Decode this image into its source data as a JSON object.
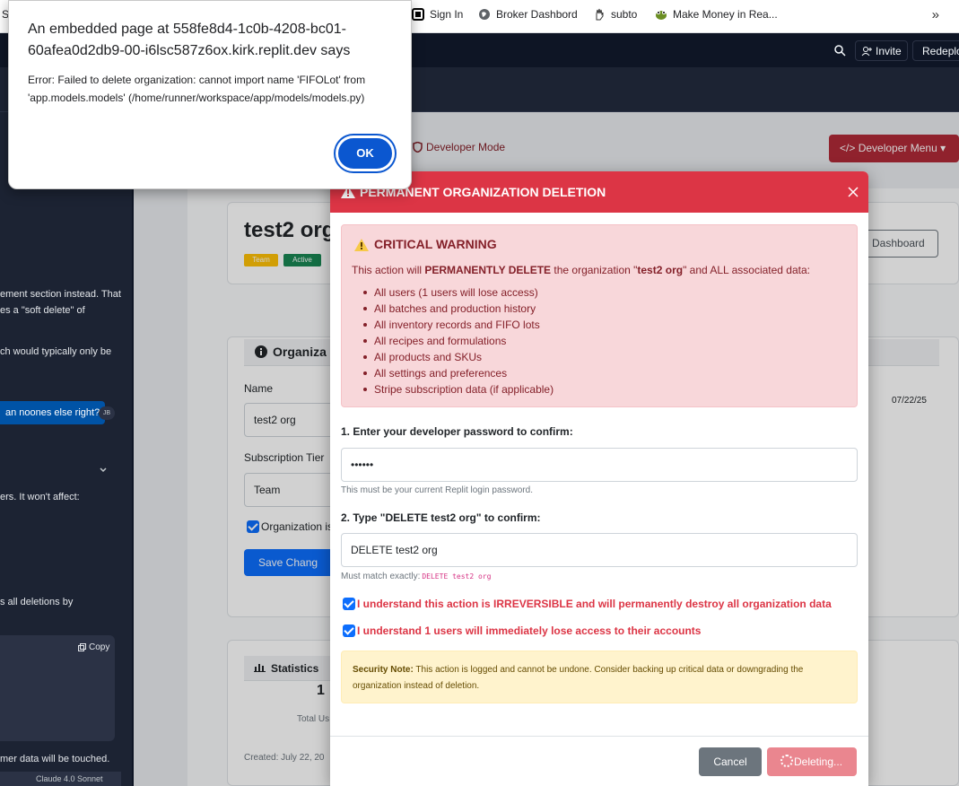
{
  "bookmarks": {
    "partial_left": "S",
    "items": [
      {
        "label": "Sign In",
        "icon": "sign-in-icon"
      },
      {
        "label": "Broker Dashbord",
        "icon": "globe-icon"
      },
      {
        "label": "subto",
        "icon": "hand-icon"
      },
      {
        "label": "Make Money in Rea...",
        "icon": "frog-icon"
      }
    ],
    "more": "»"
  },
  "replit": {
    "invite_label": "Invite",
    "redeploy_label": "Redeploy"
  },
  "chat": {
    "lines": [
      "ement section instead. That",
      "es a \"soft delete\" of",
      "ch would typically only be",
      "ers. It won't affect:",
      "s all deletions by",
      "mer data will be touched."
    ],
    "bubble": "an noones else right?",
    "avatar": "JB",
    "copy_label": "Copy",
    "model": "Claude 4.0 Sonnet"
  },
  "app": {
    "developer_mode": "Developer Mode",
    "developer_menu": "Developer Menu",
    "org_title": "test2 org",
    "badge_tier": "Team",
    "badge_status": "Active",
    "dashboard_btn": "Dashboard",
    "info_section": "Organiza",
    "name_label": "Name",
    "name_value": "test2 org",
    "tier_label": "Subscription Tier",
    "tier_value": "Team",
    "active_label": "Organization is",
    "save_label": "Save Chang",
    "date_value": "07/22/25",
    "stats_label": "Statistics",
    "stats_value": "1",
    "stats_sub": "Total Us",
    "created": "Created: July 22, 20"
  },
  "modal": {
    "title": "PERMANENT ORGANIZATION DELETION",
    "warning_title": "CRITICAL WARNING",
    "warning_prefix": "This action will ",
    "warning_bold": "PERMANENTLY DELETE",
    "warning_mid": " the organization \"",
    "warning_org": "test2 org",
    "warning_suffix": "\" and ALL associated data:",
    "warning_items": [
      "All users (1 users will lose access)",
      "All batches and production history",
      "All inventory records and FIFO lots",
      "All recipes and formulations",
      "All products and SKUs",
      "All settings and preferences",
      "Stripe subscription data (if applicable)"
    ],
    "step1_label": "1. Enter your developer password to confirm:",
    "password_value": "••••••",
    "step1_help": "This must be your current Replit login password.",
    "step2_label": "2. Type \"DELETE test2 org\" to confirm:",
    "confirm_value": "DELETE test2 org",
    "step2_help": "Must match exactly:",
    "step2_code": "DELETE test2 org",
    "check1": "I understand this action is IRREVERSIBLE and will permanently destroy all organization data",
    "check2": "I understand 1 users will immediately lose access to their accounts",
    "note_bold": "Security Note:",
    "note_text": " This action is logged and cannot be undone. Consider backing up critical data or downgrading the organization instead of deletion.",
    "cancel_label": "Cancel",
    "delete_label": "Deleting..."
  },
  "alert": {
    "title": "An embedded page at 558fe8d4-1c0b-4208-bc01-60afea0d2db9-00-i6lsc587z6ox.kirk.replit.dev says",
    "message": "Error: Failed to delete organization: cannot import name 'FIFOLot' from 'app.models.models' (/home/runner/workspace/app/models/models.py)",
    "ok_label": "OK"
  },
  "colors": {
    "danger": "#dc3545",
    "primary": "#0d6efd",
    "alert_ok": "#0b57d0",
    "replit_bg": "#1c2333"
  }
}
